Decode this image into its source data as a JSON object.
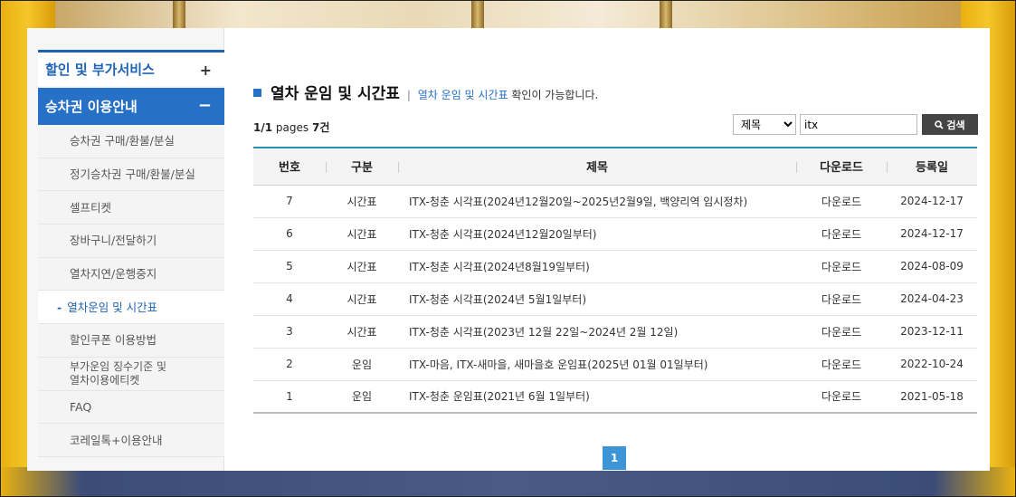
{
  "sidebar": {
    "top_item": {
      "label": "할인 및 부가서비스",
      "toggle": "+"
    },
    "active_item": {
      "label": "승차권 이용안내",
      "toggle": "−"
    },
    "sub_items": [
      {
        "label": "승차권 구매/환불/분실"
      },
      {
        "label": "정기승차권 구매/환불/분실"
      },
      {
        "label": "셀프티켓"
      },
      {
        "label": "장바구니/전달하기"
      },
      {
        "label": "열차지연/운행중지"
      },
      {
        "label": "열차운임 및 시간표"
      },
      {
        "label": "할인쿠폰 이용방법"
      },
      {
        "label": "부가운임 징수기준 및 열차이용에티켓"
      },
      {
        "label": "FAQ"
      },
      {
        "label": "코레일톡+이용안내"
      }
    ],
    "selected_marker": "-"
  },
  "main": {
    "title": "열차 운임 및 시간표",
    "desc_sep": "|",
    "desc_highlight": "열차 운임 및 시간표",
    "desc_rest": "확인이 가능합니다.",
    "page_info": {
      "current": "1/1",
      "pages_word": "pages",
      "count": "7건"
    },
    "search": {
      "field_options": [
        "제목"
      ],
      "selected_field": "제목",
      "query": "itx",
      "button_label": "검색"
    },
    "table": {
      "headers": [
        "번호",
        "구분",
        "제목",
        "다운로드",
        "등록일"
      ],
      "rows": [
        {
          "no": "7",
          "type": "시간표",
          "title": "ITX-청춘 시각표(2024년12월20일~2025년2월9일, 백양리역 임시정차)",
          "download": "다운로드",
          "date": "2024-12-17"
        },
        {
          "no": "6",
          "type": "시간표",
          "title": "ITX-청춘 시각표(2024년12월20일부터)",
          "download": "다운로드",
          "date": "2024-12-17"
        },
        {
          "no": "5",
          "type": "시간표",
          "title": "ITX-청춘 시각표(2024년8월19일부터)",
          "download": "다운로드",
          "date": "2024-08-09"
        },
        {
          "no": "4",
          "type": "시간표",
          "title": "ITX-청춘 시각표(2024년 5월1일부터)",
          "download": "다운로드",
          "date": "2024-04-23"
        },
        {
          "no": "3",
          "type": "시간표",
          "title": "ITX-청춘 시각표(2023년 12월 22일~2024년 2월 12일)",
          "download": "다운로드",
          "date": "2023-12-11"
        },
        {
          "no": "2",
          "type": "운임",
          "title": "ITX-마음, ITX-새마을, 새마을호 운임표(2025년 01월 01일부터)",
          "download": "다운로드",
          "date": "2022-10-24"
        },
        {
          "no": "1",
          "type": "운임",
          "title": "ITX-청춘 운임표(2021년 6월 1일부터)",
          "download": "다운로드",
          "date": "2021-05-18"
        }
      ]
    },
    "pagination": {
      "current_page": "1"
    }
  },
  "colors": {
    "accent_blue": "#2670c8",
    "table_top_border": "#2a8fb2",
    "search_button": "#444444",
    "pager_active": "#3d95d8"
  }
}
